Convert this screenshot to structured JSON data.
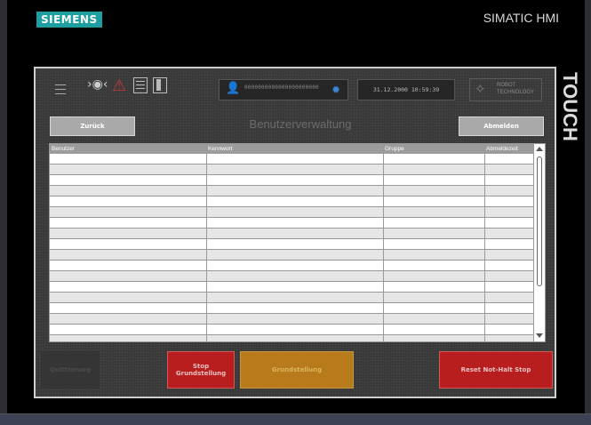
{
  "header": {
    "brand": "SIEMENS",
    "product": "SIMATIC HMI",
    "side_label": "TOUCH"
  },
  "topbar": {
    "user_display": "0000000000000000000000",
    "datetime": "31.12.2000 10:59:39",
    "logo_line1": "ROBOT",
    "logo_line2": "TECHNOLOGY",
    "icons": [
      "menu-icon",
      "camera-icon",
      "warning-icon",
      "list-icon",
      "door-icon",
      "user-icon",
      "gear-icon"
    ]
  },
  "page": {
    "title": "Benutzerverwaltung",
    "back_label": "Zurück",
    "logout_label": "Abmelden"
  },
  "table": {
    "columns": [
      "Benutzer",
      "Kennwort",
      "Gruppe",
      "Abmeldezeit"
    ]
  },
  "bottom": {
    "quit_label": "Quittierung",
    "stop_line1": "Stop",
    "stop_line2": "Grundstellung",
    "home_label": "Grundstellung",
    "reset_label": "Reset Not-Halt Stop"
  },
  "colors": {
    "brand": "#1d9ea0",
    "danger": "#b81e1e",
    "warning": "#b77b1b",
    "button_gray": "#a9a9a9"
  }
}
